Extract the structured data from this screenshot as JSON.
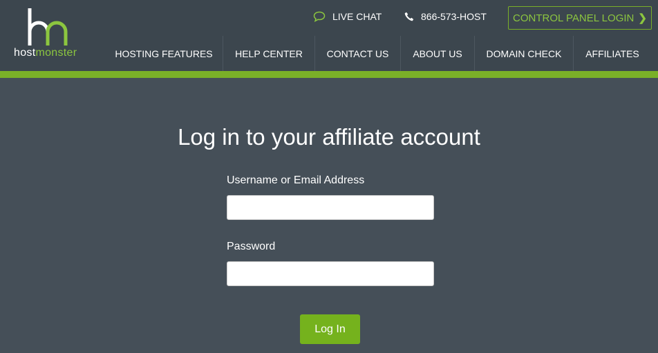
{
  "brand": {
    "logo_host": "host",
    "logo_monster": "monster",
    "accent_color": "#7ab028"
  },
  "utility": {
    "live_chat_label": "LIVE CHAT",
    "phone_label": "866-573-HOST",
    "control_panel_label": "CONTROL PANEL LOGIN"
  },
  "nav": {
    "items": [
      {
        "label": "HOSTING FEATURES"
      },
      {
        "label": "HELP CENTER"
      },
      {
        "label": "CONTACT US"
      },
      {
        "label": "ABOUT US"
      },
      {
        "label": "DOMAIN CHECK"
      },
      {
        "label": "AFFILIATES"
      }
    ]
  },
  "login": {
    "title": "Log in to your affiliate account",
    "username_label": "Username or Email Address",
    "username_value": "",
    "password_label": "Password",
    "password_value": "",
    "submit_label": "Log In"
  }
}
